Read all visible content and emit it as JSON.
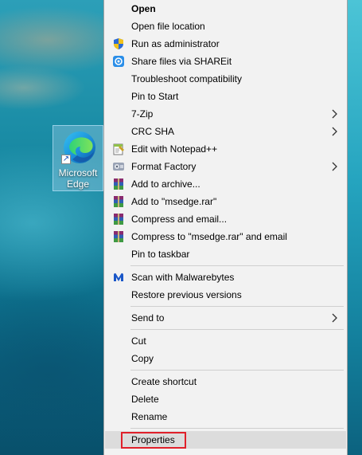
{
  "desktop": {
    "shortcut": {
      "label": "Microsoft Edge",
      "icon": "edge-icon"
    }
  },
  "menu": {
    "items": [
      {
        "label": "Open",
        "bold": true
      },
      {
        "label": "Open file location"
      },
      {
        "label": "Run as administrator",
        "icon": "shield-icon"
      },
      {
        "label": "Share files via SHAREit",
        "icon": "shareit-icon"
      },
      {
        "label": "Troubleshoot compatibility"
      },
      {
        "label": "Pin to Start"
      },
      {
        "label": "7-Zip",
        "submenu": true
      },
      {
        "label": "CRC SHA",
        "submenu": true
      },
      {
        "label": "Edit with Notepad++",
        "icon": "notepad-plus-icon"
      },
      {
        "label": "Format Factory",
        "icon": "format-factory-icon",
        "submenu": true
      },
      {
        "label": "Add to archive...",
        "icon": "winrar-icon"
      },
      {
        "label": "Add to \"msedge.rar\"",
        "icon": "winrar-icon"
      },
      {
        "label": "Compress and email...",
        "icon": "winrar-icon"
      },
      {
        "label": "Compress to \"msedge.rar\" and email",
        "icon": "winrar-icon"
      },
      {
        "label": "Pin to taskbar"
      },
      {
        "label": "Scan with Malwarebytes",
        "icon": "malwarebytes-icon"
      },
      {
        "label": "Restore previous versions"
      },
      {
        "label": "Send to",
        "submenu": true
      },
      {
        "label": "Cut"
      },
      {
        "label": "Copy"
      },
      {
        "label": "Create shortcut"
      },
      {
        "label": "Delete"
      },
      {
        "label": "Rename"
      },
      {
        "label": "Properties",
        "selected": true,
        "highlighted": true
      }
    ]
  },
  "colors": {
    "highlight_border": "#e0202a",
    "menu_background": "#f2f2f2"
  }
}
